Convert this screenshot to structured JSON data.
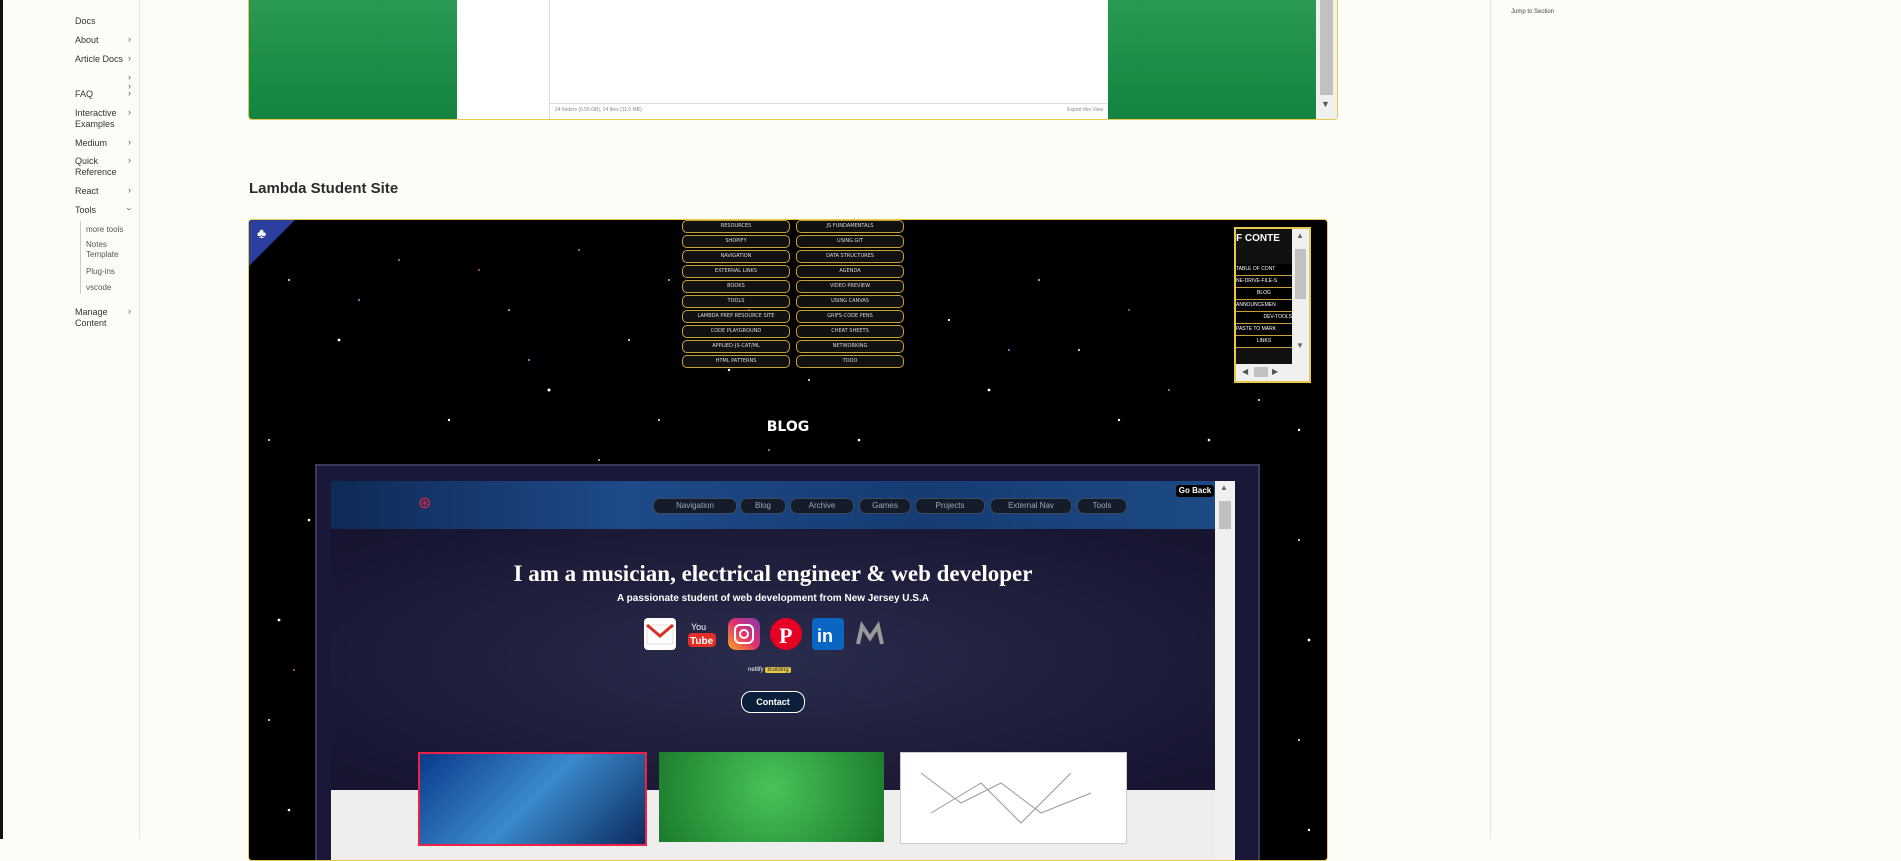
{
  "sidebar": {
    "items": [
      {
        "label": "Docs"
      },
      {
        "label": "About"
      },
      {
        "label": "Article Docs"
      },
      {
        "label": ""
      },
      {
        "label": "FAQ"
      },
      {
        "label": "Interactive Examples"
      },
      {
        "label": "Medium"
      },
      {
        "label": "Quick Reference"
      },
      {
        "label": "React"
      },
      {
        "label": "Tools"
      },
      {
        "label": "Manage Content"
      }
    ],
    "tools_children": [
      "more tools",
      "Notes Template",
      "Plug-ins",
      "vscode"
    ]
  },
  "file_viewer": {
    "status": "24 folders (6.55 GB), 24 files (11.6 MB)",
    "export_link": "Export this View"
  },
  "section": {
    "title": "Lambda Student Site"
  },
  "toc_menu": {
    "left": [
      "RESOURCES",
      "SHOPIFY",
      "NAVIGATION",
      "EXTERNAL LINKS",
      "BOOKS",
      "TOOLS",
      "LAMBDA PREP RESOURCE SITE",
      "CODE PLAYGROUND",
      "APPLIED-JS-CAT/ML",
      "HTML PATTERNS"
    ],
    "right": [
      "JS FUNDAMENTALS",
      "USING GIT",
      "DATA STRUCTURES",
      "AGENDA",
      "VIDEO PREVIEW",
      "USING CANVAS",
      "GRIFS-CODE PENS",
      "CHEAT SHEETS",
      "NETWORKING",
      "TODO"
    ]
  },
  "toc_panel": {
    "header": "F CONTE",
    "items": [
      "TABLE OF CONT",
      "NE-DRIVE-FILE-S",
      "BLOG",
      "ANNOUNCEMEN",
      "DEV-TOOLS",
      "PASTE TO MARK",
      "LINKS"
    ]
  },
  "blog": {
    "heading": "BLOG"
  },
  "inner_site": {
    "nav": [
      "Navigation",
      "Blog",
      "Archive",
      "Games",
      "Projects",
      "External Nav",
      "Tools"
    ],
    "go_back": "Go Back",
    "headline": "I am a musician, electrical engineer & web developer",
    "subhead": "A passionate student of web development from New Jersey U.S.A",
    "badge_netlify": "netlify",
    "badge_status": "Building",
    "contact": "Contact"
  },
  "right_panel": {
    "jump_label": "Jump to Section"
  },
  "colors": {
    "accent_border": "#e7c94a",
    "green_panel": "#1a8c45",
    "space_bg": "#000000",
    "nav_gold": "#c9a033"
  },
  "icons": {
    "social": [
      "gmail-icon",
      "youtube-icon",
      "instagram-icon",
      "pinterest-icon",
      "linkedin-icon",
      "medium-icon"
    ]
  }
}
